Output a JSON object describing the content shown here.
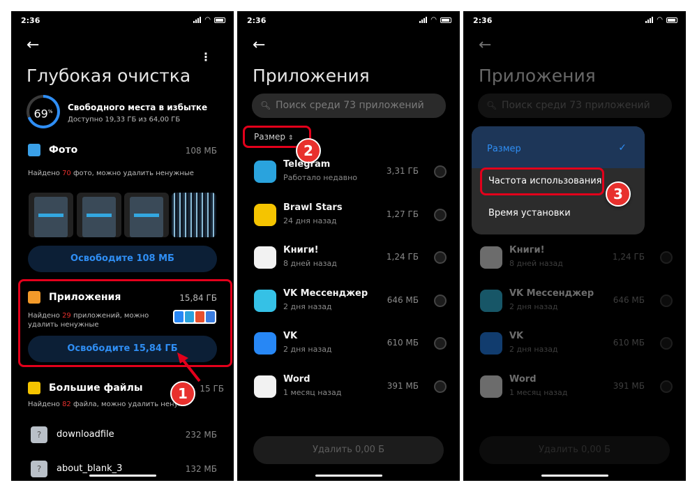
{
  "colors": {
    "accent": "#2f8ef4",
    "highlight_red": "#e3001b",
    "background": "#000000"
  },
  "status": {
    "time": "2:36"
  },
  "panel1": {
    "title": "Глубокая очистка",
    "gauge": {
      "percent": 69,
      "value": "69",
      "unit": "%"
    },
    "excess_title": "Свободного места в избытке",
    "excess_sub": "Доступно 19,33 ГБ из 64,00 ГБ",
    "photos": {
      "label": "Фото",
      "size": "108 МБ",
      "found_prefix": "Найдено ",
      "found_count": "70",
      "found_suffix": " фото, можно удалить ненужные",
      "free_button": "Освободите 108 МБ"
    },
    "apps": {
      "label": "Приложения",
      "size": "15,84 ГБ",
      "found_prefix": "Найдено ",
      "found_count": "29",
      "found_suffix": " приложений, можно",
      "found_line2": "удалить ненужные",
      "free_button": "Освободите 15,84 ГБ"
    },
    "large_files": {
      "label": "Большие файлы",
      "size": "15 ГБ",
      "found_prefix": "Найдено ",
      "found_count": "82",
      "found_suffix": " файла, можно удалить ненуж"
    },
    "files": [
      {
        "name": "downloadfile",
        "size": "232 МБ",
        "icon": "question-icon"
      },
      {
        "name": "about_blank_3",
        "size": "132 МБ",
        "icon": "question-icon"
      }
    ],
    "badge": "1"
  },
  "panel2": {
    "title": "Приложения",
    "search_placeholder": "Поиск среди 73 приложений",
    "sort_label": "Размер",
    "badge": "2",
    "apps": [
      {
        "name": "Telegram",
        "sub": "Работало недавно",
        "size": "3,31 ГБ",
        "icon": "telegram-icon",
        "color": "#2aa3dd"
      },
      {
        "name": "Brawl Stars",
        "sub": "24 дня назад",
        "size": "1,27 ГБ",
        "icon": "brawl-stars-icon",
        "color": "#f5c400"
      },
      {
        "name": "Книги!",
        "sub": "8 дней назад",
        "size": "1,24 ГБ",
        "icon": "books-icon",
        "color": "#f2f2f2"
      },
      {
        "name": "VK Мессенджер",
        "sub": "2 дня назад",
        "size": "646 МБ",
        "icon": "vk-messenger-icon",
        "color": "#35c1e6"
      },
      {
        "name": "VK",
        "sub": "2 дня назад",
        "size": "610 МБ",
        "icon": "vk-icon",
        "color": "#2787f5"
      },
      {
        "name": "Word",
        "sub": "1 месяц назад",
        "size": "391 МБ",
        "icon": "word-icon",
        "color": "#f2f2f2"
      }
    ],
    "delete_button": "Удалить 0,00 Б"
  },
  "panel3": {
    "title": "Приложения",
    "search_placeholder": "Поиск среди 73 приложений",
    "menu": {
      "items": [
        {
          "label": "Размер",
          "selected": true
        },
        {
          "label": "Частота использования",
          "selected": false
        },
        {
          "label": "Время установки",
          "selected": false
        }
      ]
    },
    "badge": "3",
    "apps": [
      {
        "name": "Книги!",
        "sub": "8 дней назад",
        "size": "1,24 ГБ"
      },
      {
        "name": "VK Мессенджер",
        "sub": "2 дня назад",
        "size": "646 МБ"
      },
      {
        "name": "VK",
        "sub": "2 дня назад",
        "size": "610 МБ"
      },
      {
        "name": "Word",
        "sub": "1 месяц назад",
        "size": "391 МБ"
      }
    ],
    "delete_button": "Удалить 0,00 Б"
  }
}
